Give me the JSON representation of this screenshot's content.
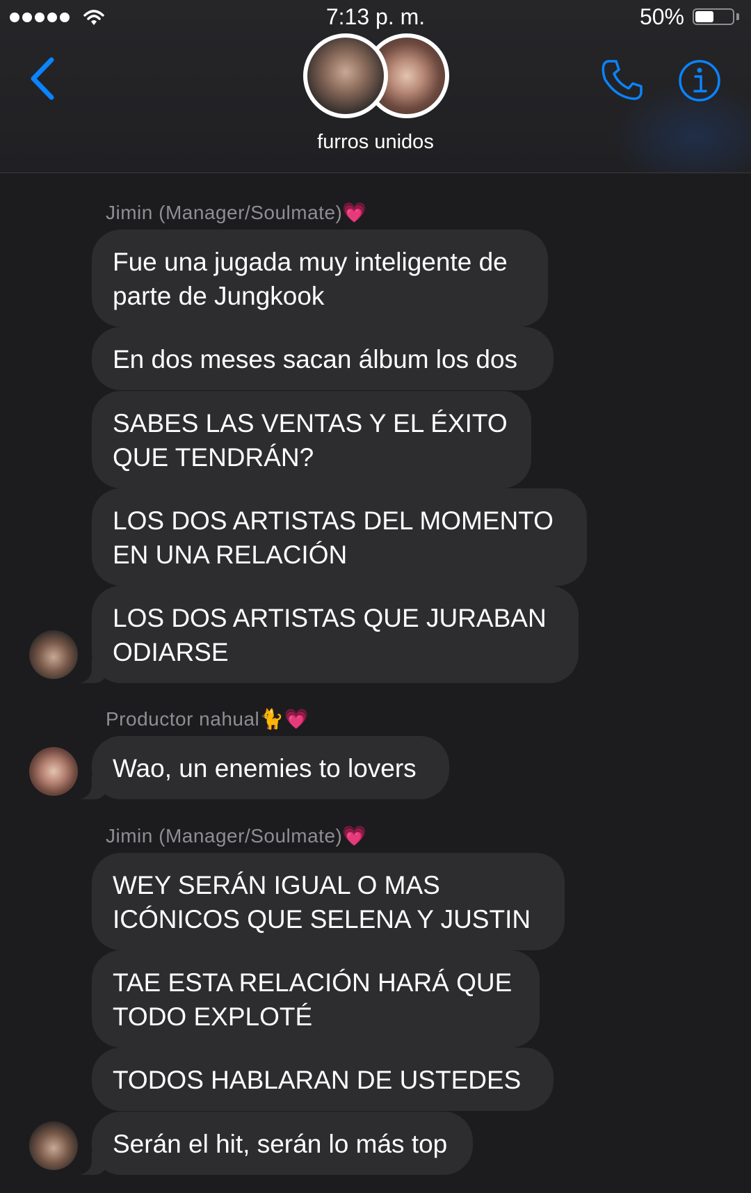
{
  "status_bar": {
    "time": "7:13 p. m.",
    "battery_percent": "50%",
    "battery_level": 0.5
  },
  "header": {
    "group_name": "furros unidos",
    "back_icon": "chevron-left-icon",
    "call_icon": "phone-icon",
    "info_icon": "info-icon"
  },
  "colors": {
    "accent": "#0a84ff",
    "bubble": "#2d2d30",
    "background": "#1c1c1e",
    "sender_name": "#8e8e93"
  },
  "senders": {
    "jimin": "Jimin (Manager/Soulmate)💗",
    "productor": "Productor nahual🐈💗"
  },
  "messages": {
    "m1": "Fue una jugada muy inteligente de parte de Jungkook",
    "m2": "En dos meses sacan álbum los dos",
    "m3": "SABES LAS VENTAS Y EL ÉXITO QUE TENDRÁN?",
    "m4": "LOS DOS ARTISTAS DEL MOMENTO EN UNA RELACIÓN",
    "m5": "LOS DOS ARTISTAS QUE JURABAN ODIARSE",
    "m6": "Wao, un enemies to lovers",
    "m7": "WEY SERÁN IGUAL O MAS ICÓNICOS QUE SELENA Y JUSTIN",
    "m8": "TAE ESTA RELACIÓN HARÁ QUE TODO EXPLOTÉ",
    "m9": "TODOS HABLARAN DE USTEDES",
    "m10": "Serán el hit, serán lo más top"
  }
}
